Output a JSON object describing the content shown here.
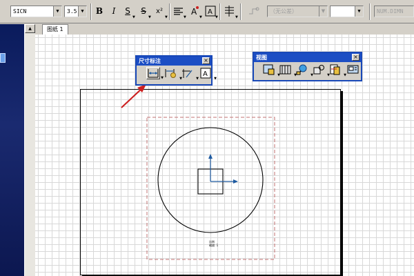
{
  "toolbar": {
    "font_name": "SICN",
    "font_size": "3.5",
    "bold": "B",
    "italic": "I",
    "underline": "S",
    "strike": "S",
    "superscript": "x²",
    "tolerance_placeholder": "（无公差）",
    "dim_text": "NUM.DIMN"
  },
  "tabs": [
    {
      "label": "图纸 1"
    }
  ],
  "dim_toolbar": {
    "title": "尺寸标注"
  },
  "view_toolbar": {
    "title": "视图"
  },
  "drawing": {
    "note_line1": "比例",
    "note_line2": "缩放: 1"
  },
  "colors": {
    "title_bar": "#1c4ec4",
    "arrow": "#cc2020",
    "axis": "#1e5aa0",
    "dash": "#c07070"
  }
}
